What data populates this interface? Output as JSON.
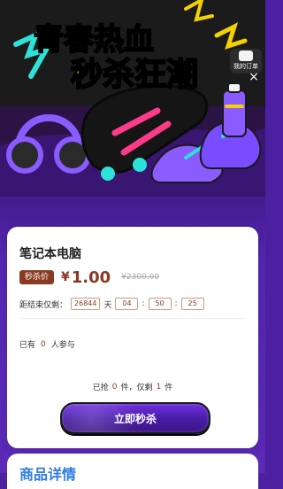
{
  "banner": {
    "headline_1": "青春热血",
    "headline_2": "秒杀狂潮",
    "orders_label": "我的订单",
    "close_label": "×"
  },
  "product": {
    "title": "笔记本电脑",
    "flash_badge": "秒杀价",
    "currency": "¥",
    "price": "1.00",
    "original_price": "¥2300.00"
  },
  "countdown": {
    "label": "距结束仅剩：",
    "days": "26844",
    "day_unit": "天",
    "hours": "04",
    "minutes": "50",
    "seconds": "25",
    "separator": ":"
  },
  "participants": {
    "prefix": "已有",
    "count": "0",
    "suffix": "人参与"
  },
  "stock": {
    "prefix": "已抢",
    "grabbed": "0",
    "mid": "件，仅剩",
    "remaining": "1",
    "suffix": "件"
  },
  "cta": {
    "label": "立即秒杀"
  },
  "details": {
    "title": "商品详情"
  },
  "colors": {
    "accent_red": "#8a3a22",
    "details_blue": "#2d7be2",
    "bg_purple": "#4d1fa1"
  }
}
